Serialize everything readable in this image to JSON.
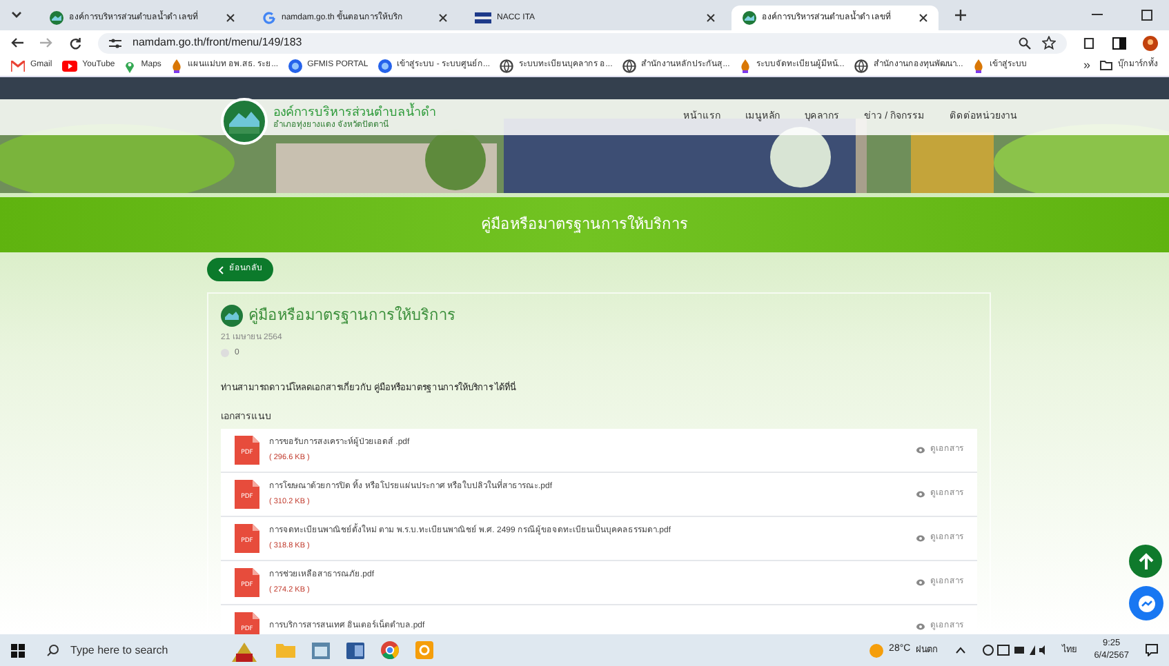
{
  "browser": {
    "tabs": [
      {
        "title": "องค์การบริหารส่วนตำบลน้ำดำ เลขที่",
        "selected": false
      },
      {
        "title": "namdam.go.th ขั้นตอนการให้บริก",
        "selected": false
      },
      {
        "title": "NACC ITA",
        "selected": false
      },
      {
        "title": "องค์การบริหารส่วนตำบลน้ำดำ เลขที่",
        "selected": true
      }
    ],
    "address": "namdam.go.th/front/menu/149/183",
    "bookmarks": [
      {
        "label": "Gmail"
      },
      {
        "label": "YouTube"
      },
      {
        "label": "Maps"
      },
      {
        "label": "แผนแม่บท อพ.สธ. ระย..."
      },
      {
        "label": "GFMIS PORTAL"
      },
      {
        "label": "เข้าสู่ระบบ - ระบบศูนย์ก..."
      },
      {
        "label": "ระบบทะเบียนบุคลากร อ..."
      },
      {
        "label": "สำนักงานหลักประกันสุ..."
      },
      {
        "label": "ระบบจัดทะเบียนผู้มีหน้..."
      },
      {
        "label": "สำนักงานกองทุนพัฒนา..."
      },
      {
        "label": "เข้าสู่ระบบ"
      }
    ],
    "more": "»",
    "all_bookmarks": "บุ๊กมาร์กทั้ง"
  },
  "site": {
    "name": "องค์การบริหารส่วนตำบลน้ำดำ",
    "subtitle": "อำเภอทุ่งยางแดง จังหวัดปัตตานี",
    "nav": [
      "หน้าแรก",
      "เมนูหลัก",
      "บุคลากร",
      "ข่าว / กิจกรรม",
      "ติดต่อหน่วยงาน"
    ],
    "page_title": "คู่มือหรือมาตรฐานการให้บริการ",
    "back_label": "ย้อนกลับ",
    "card": {
      "title": "คู่มือหรือมาตรฐานการให้บริการ",
      "date": "21 เมษายน 2564",
      "views": "0",
      "description": "ท่านสามารถดาวน์โหลดเอกสารเกี่ยวกับ คู่มือหรือมาตรฐานการให้บริการ ได้ที่นี่",
      "attachments_heading": "เอกสารแนบ",
      "files": [
        {
          "badge": "PDF",
          "name": "การขอรับการสงเคราะห์ผู้ป่วยเอดส์ .pdf",
          "size": "( 296.6 KB )",
          "action": "ดูเอกสาร"
        },
        {
          "badge": "PDF",
          "name": "การโฆษณาด้วยการปิด ทิ้ง หรือโปรยแผ่นประกาศ หรือใบปลิวในที่สาธารณะ.pdf",
          "size": "( 310.2 KB )",
          "action": "ดูเอกสาร"
        },
        {
          "badge": "PDF",
          "name": "การจดทะเบียนพาณิชย์ตั้งใหม่ ตาม พ.ร.บ.ทะเบียนพาณิชย์ พ.ศ. 2499 กรณีผู้ขอจดทะเบียนเป็นบุคคลธรรมดา.pdf",
          "size": "( 318.8 KB )",
          "action": "ดูเอกสาร"
        },
        {
          "badge": "PDF",
          "name": "การช่วยเหลือสาธารณภัย.pdf",
          "size": "( 274.2 KB )",
          "action": "ดูเอกสาร"
        },
        {
          "badge": "PDF",
          "name": "การบริการสารสนเทศ อินเตอร์เน็ตตำบล.pdf",
          "action": "ดูเอกสาร"
        }
      ]
    }
  },
  "taskbar": {
    "search_placeholder": "Type here to search",
    "temperature": "28°C",
    "weather": "ฝนตก",
    "language": "ไทย",
    "time": "9:25",
    "date": "6/4/2567"
  }
}
